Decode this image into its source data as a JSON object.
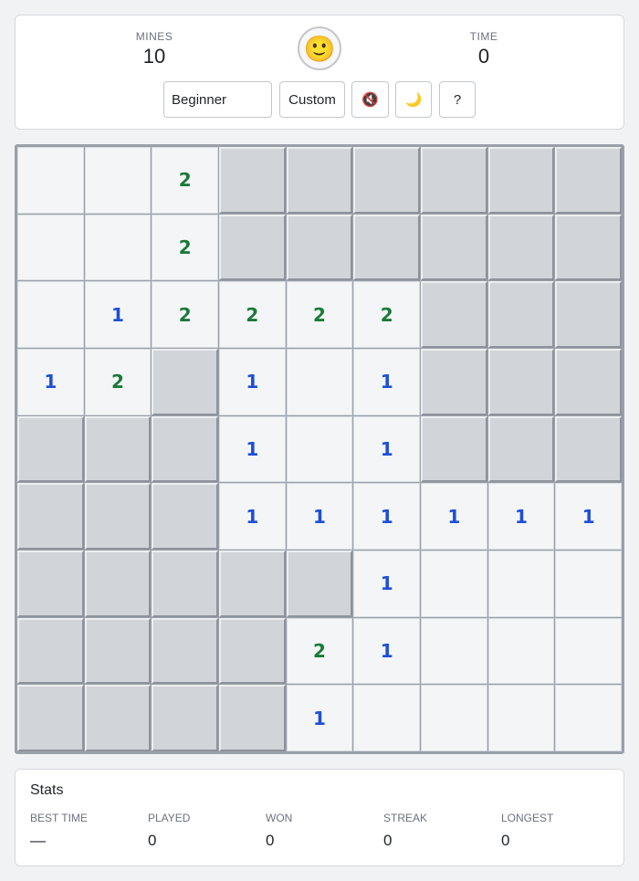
{
  "header": {
    "mines_label": "MINES",
    "mines_value": "10",
    "time_label": "TIME",
    "time_value": "0",
    "face": "🙂",
    "difficulty": "Beginner",
    "custom_label": "Custom",
    "sound_icon": "🔇",
    "theme_icon": "🌙",
    "help_label": "?"
  },
  "board": {
    "rows": 9,
    "cols": 9,
    "cells": [
      [
        " ",
        " ",
        "2",
        "#",
        "#",
        "#",
        "#",
        "#",
        "#"
      ],
      [
        " ",
        " ",
        "2",
        "#",
        "#",
        "#",
        "#",
        "#",
        "#"
      ],
      [
        " ",
        "1",
        "2",
        "2",
        "2",
        "2",
        "#",
        "#",
        "#"
      ],
      [
        "1",
        "2",
        "#",
        "1",
        " ",
        "1",
        "#",
        "#",
        "#"
      ],
      [
        "#",
        "#",
        "#",
        "1",
        " ",
        "1",
        "#",
        "#",
        "#"
      ],
      [
        "#",
        "#",
        "#",
        "1",
        "1",
        "1",
        "1",
        "1",
        "1"
      ],
      [
        "#",
        "#",
        "#",
        "#",
        "#",
        "1",
        " ",
        " ",
        " "
      ],
      [
        "#",
        "#",
        "#",
        "#",
        "2",
        "1",
        " ",
        " ",
        " "
      ],
      [
        "#",
        "#",
        "#",
        "#",
        "1",
        " ",
        " ",
        " ",
        " "
      ]
    ]
  },
  "stats": {
    "title": "Stats",
    "items": [
      {
        "label": "BEST TIME",
        "value": "—"
      },
      {
        "label": "PLAYED",
        "value": "0"
      },
      {
        "label": "WON",
        "value": "0"
      },
      {
        "label": "STREAK",
        "value": "0"
      },
      {
        "label": "LONGEST",
        "value": "0"
      }
    ]
  }
}
